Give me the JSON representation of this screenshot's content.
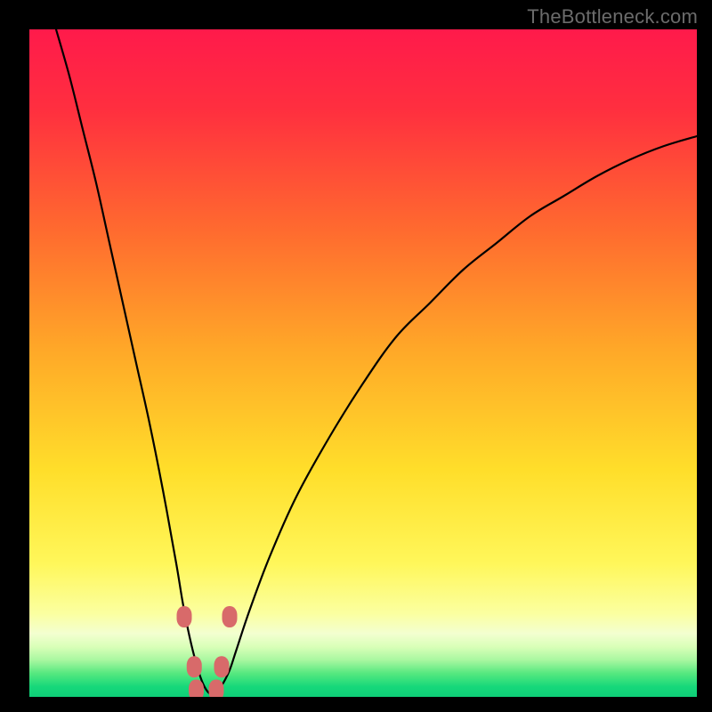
{
  "watermark": {
    "text": "TheBottleneck.com"
  },
  "colors": {
    "black": "#000000",
    "curve": "#000000",
    "marker_fill": "#d86a6a",
    "marker_stroke": "#c95757",
    "gradient_stops": [
      {
        "offset": 0.0,
        "color": "#ff1a4b"
      },
      {
        "offset": 0.12,
        "color": "#ff2f3f"
      },
      {
        "offset": 0.3,
        "color": "#ff6a2f"
      },
      {
        "offset": 0.48,
        "color": "#ffa828"
      },
      {
        "offset": 0.66,
        "color": "#ffde2a"
      },
      {
        "offset": 0.8,
        "color": "#fff75a"
      },
      {
        "offset": 0.875,
        "color": "#fbffa0"
      },
      {
        "offset": 0.905,
        "color": "#f3ffd0"
      },
      {
        "offset": 0.925,
        "color": "#d9ffb8"
      },
      {
        "offset": 0.945,
        "color": "#a8f7a0"
      },
      {
        "offset": 0.965,
        "color": "#55e87f"
      },
      {
        "offset": 0.985,
        "color": "#16d87a"
      },
      {
        "offset": 1.0,
        "color": "#0fce78"
      }
    ]
  },
  "chart_data": {
    "type": "line",
    "title": "",
    "xlabel": "",
    "ylabel": "",
    "xlim": [
      0,
      100
    ],
    "ylim": [
      0,
      100
    ],
    "note": "Bottleneck-style curve. y≈100 means poor match (red, top); y≈0 means ideal match (green, bottom). Minimum is near x≈27.",
    "series": [
      {
        "name": "bottleneck_curve",
        "x": [
          4,
          6,
          8,
          10,
          12,
          14,
          16,
          18,
          20,
          22,
          23,
          24,
          25,
          26,
          27,
          28,
          29,
          30,
          31,
          33,
          36,
          40,
          45,
          50,
          55,
          60,
          65,
          70,
          75,
          80,
          85,
          90,
          95,
          100
        ],
        "y": [
          100,
          93,
          85,
          77,
          68,
          59,
          50,
          41,
          31,
          20,
          14,
          9,
          5,
          2,
          0.5,
          0.5,
          2,
          4,
          7,
          13,
          21,
          30,
          39,
          47,
          54,
          59,
          64,
          68,
          72,
          75,
          78,
          80.5,
          82.5,
          84
        ]
      }
    ],
    "markers": {
      "name": "highlighted_points",
      "x": [
        23.2,
        24.7,
        28.8,
        30.0,
        25.0,
        28.0
      ],
      "y": [
        12,
        4.5,
        4.5,
        12,
        1.0,
        1.0
      ],
      "note": "rounded markers clustered around the curve minimum"
    }
  }
}
